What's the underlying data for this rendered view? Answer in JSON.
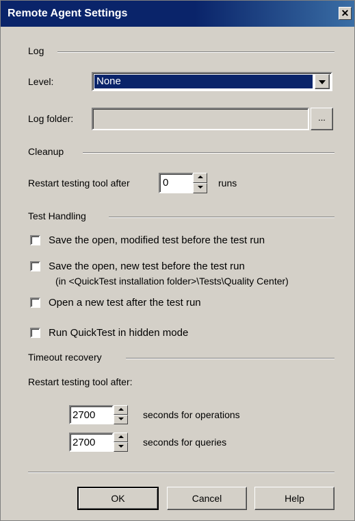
{
  "dialog": {
    "title": "Remote Agent Settings",
    "close_glyph": "✕"
  },
  "log": {
    "section_label": "Log",
    "level_label": "Level:",
    "level_value": "None",
    "folder_label": "Log folder:",
    "folder_value": "",
    "browse_label": "..."
  },
  "cleanup": {
    "section_label": "Cleanup",
    "restart_prefix": "Restart testing tool after",
    "runs_value": "0",
    "runs_suffix": "runs"
  },
  "test_handling": {
    "section_label": "Test Handling",
    "save_modified_label": "Save the open, modified test before the test run",
    "save_new_label": "Save the open, new test before the test run",
    "save_new_note": "(in <QuickTest installation folder>\\Tests\\Quality Center)",
    "open_new_label": "Open a new test after the test run",
    "hidden_mode_label": "Run QuickTest in hidden mode"
  },
  "timeout": {
    "section_label": "Timeout recovery",
    "restart_label": "Restart testing tool after:",
    "operations_value": "2700",
    "operations_suffix": "seconds for operations",
    "queries_value": "2700",
    "queries_suffix": "seconds for queries"
  },
  "buttons": {
    "ok": "OK",
    "cancel": "Cancel",
    "help": "Help"
  },
  "colors": {
    "title_bar": "#0a246a",
    "selection": "#0a246a",
    "face": "#d4d0c8"
  }
}
